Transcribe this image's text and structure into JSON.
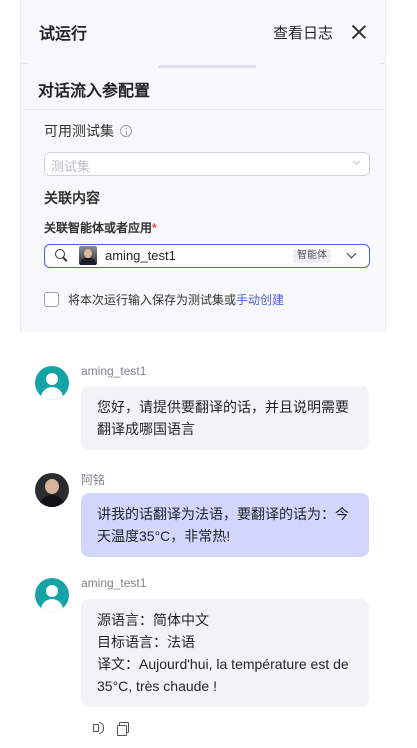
{
  "header": {
    "title": "试运行",
    "view_log": "查看日志"
  },
  "config": {
    "title": "对话流入参配置",
    "testset_label": "可用测试集",
    "testset_placeholder": "测试集",
    "related_content": "关联内容",
    "agent_label": "关联智能体或者应用",
    "required_mark": "*",
    "agent_name": "aming_test1",
    "agent_tag": "智能体",
    "save_text": "将本次运行输入保存为测试集或",
    "save_link": "手动创建"
  },
  "chat": [
    {
      "role": "bot",
      "sender": "aming_test1",
      "text": "您好，请提供要翻译的话，并且说明需要翻译成哪国语言"
    },
    {
      "role": "user",
      "sender": "阿铭",
      "text": "讲我的话翻译为法语，要翻译的话为：今天温度35°C，非常热!"
    },
    {
      "role": "bot",
      "sender": "aming_test1",
      "lines": [
        "源语言：简体中文",
        "目标语言：法语",
        "译文：Aujourd'hui, la température est de 35°C, très chaude !"
      ]
    }
  ],
  "icons": {
    "close": "close-icon",
    "info": "info-icon",
    "search": "search-icon",
    "chevron": "chevron-down-icon",
    "speaker": "speaker-icon",
    "copy": "copy-icon"
  },
  "colors": {
    "accent": "#4e5fd6",
    "bot_avatar": "#16a3a6",
    "user_bubble": "#d2d6fb",
    "bot_bubble": "#f2f3f5",
    "required": "#e5484d"
  }
}
